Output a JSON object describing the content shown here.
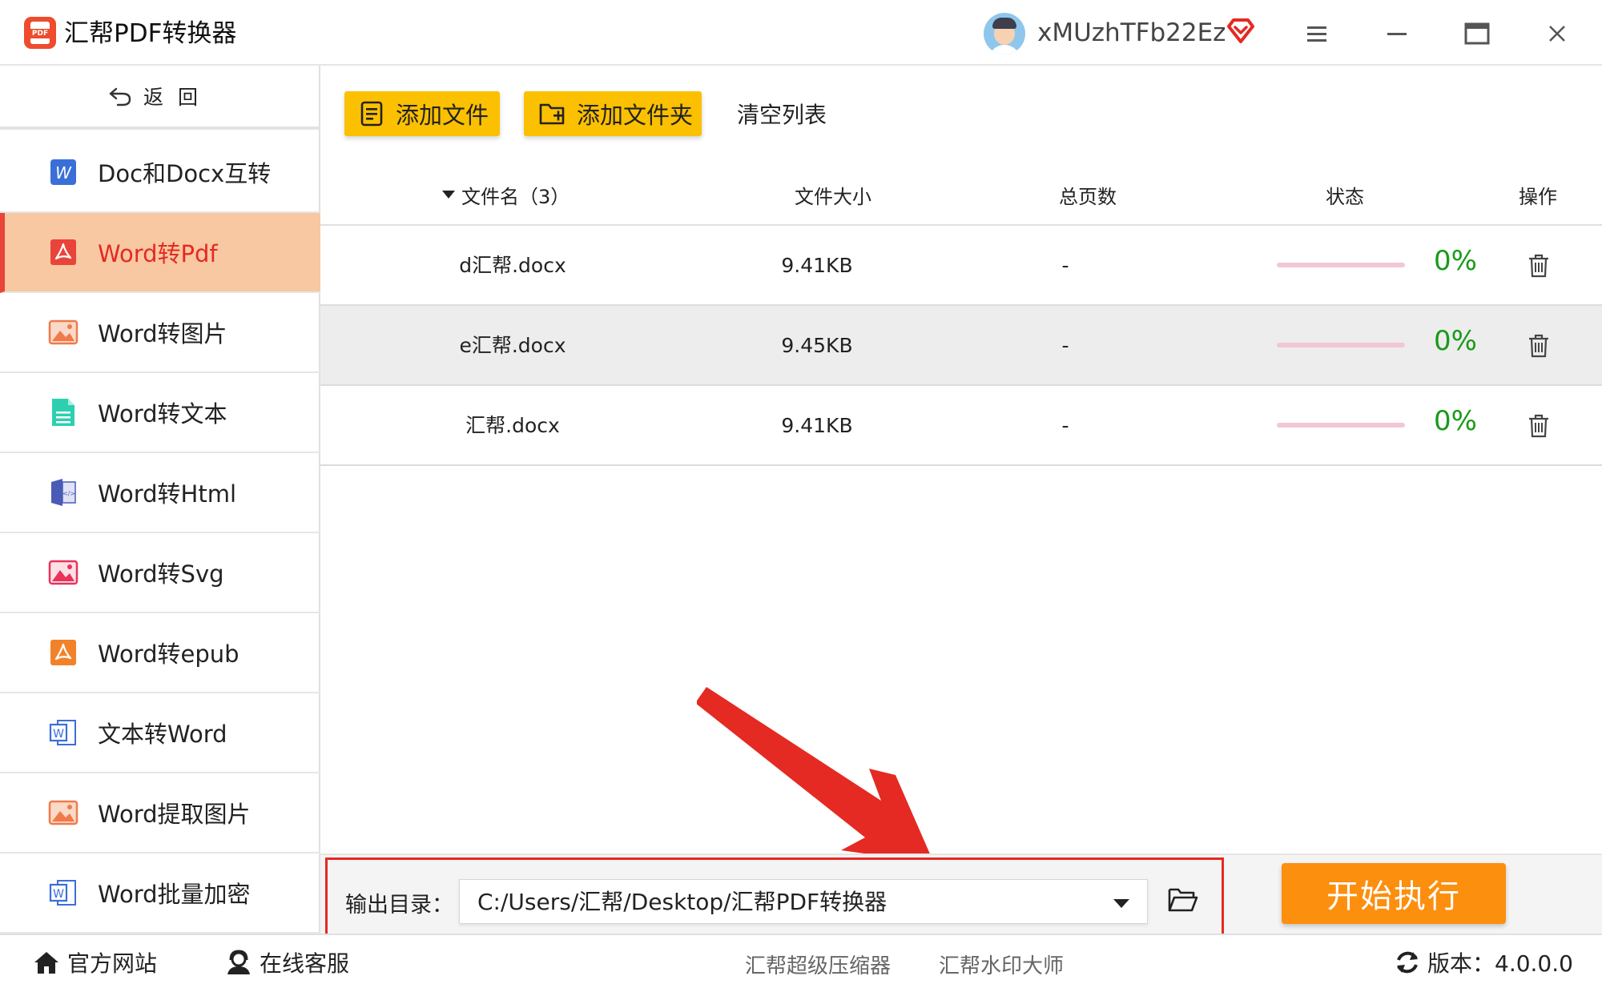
{
  "app": {
    "title": "汇帮PDF转换器",
    "logo_text": "PDF",
    "username": "xMUzhTFb22Ez"
  },
  "sidebar": {
    "back_label": "返回",
    "items": [
      {
        "label": "Doc和Docx互转",
        "icon": "word-icon",
        "color": "#3a6fd8",
        "active": false
      },
      {
        "label": "Word转Pdf",
        "icon": "pdf-icon",
        "color": "#e9443a",
        "active": true
      },
      {
        "label": "Word转图片",
        "icon": "image-icon",
        "color": "#f07a4a",
        "active": false
      },
      {
        "label": "Word转文本",
        "icon": "text-doc-icon",
        "color": "#2ecfb0",
        "active": false
      },
      {
        "label": "Word转Html",
        "icon": "html-icon",
        "color": "#4a5bb5",
        "active": false
      },
      {
        "label": "Word转Svg",
        "icon": "svg-image-icon",
        "color": "#e9335a",
        "active": false
      },
      {
        "label": "Word转epub",
        "icon": "epub-icon",
        "color": "#f2822a",
        "active": false
      },
      {
        "label": "文本转Word",
        "icon": "word-outline-icon",
        "color": "#3a6fd8",
        "active": false
      },
      {
        "label": "Word提取图片",
        "icon": "extract-image-icon",
        "color": "#f07a4a",
        "active": false
      },
      {
        "label": "Word批量加密",
        "icon": "word-lock-icon",
        "color": "#3a6fd8",
        "active": false
      }
    ]
  },
  "toolbar": {
    "add_file": "添加文件",
    "add_folder": "添加文件夹",
    "clear_list": "清空列表"
  },
  "table": {
    "headers": {
      "name": "文件名（3）",
      "size": "文件大小",
      "pages": "总页数",
      "status": "状态",
      "actions": "操作"
    },
    "rows": [
      {
        "name": "d汇帮.docx",
        "size": "9.41KB",
        "pages": "-",
        "progress": 0,
        "percent": "0%"
      },
      {
        "name": "e汇帮.docx",
        "size": "9.45KB",
        "pages": "-",
        "progress": 0,
        "percent": "0%"
      },
      {
        "name": "汇帮.docx",
        "size": "9.41KB",
        "pages": "-",
        "progress": 0,
        "percent": "0%"
      }
    ]
  },
  "output": {
    "label": "输出目录：",
    "path": "C:/Users/汇帮/Desktop/汇帮PDF转换器",
    "start_button": "开始执行"
  },
  "footer": {
    "website": "官方网站",
    "support": "在线客服",
    "link_compressor": "汇帮超级压缩器",
    "link_watermark": "汇帮水印大师",
    "version": "版本：4.0.0.0"
  },
  "colors": {
    "accent_yellow": "#fbc000",
    "start_orange": "#fc8f0e",
    "active_bg": "#f7c8a1",
    "active_text": "#e42a22",
    "percent_green": "#1a9a1a",
    "annotation_red": "#e42a22"
  }
}
